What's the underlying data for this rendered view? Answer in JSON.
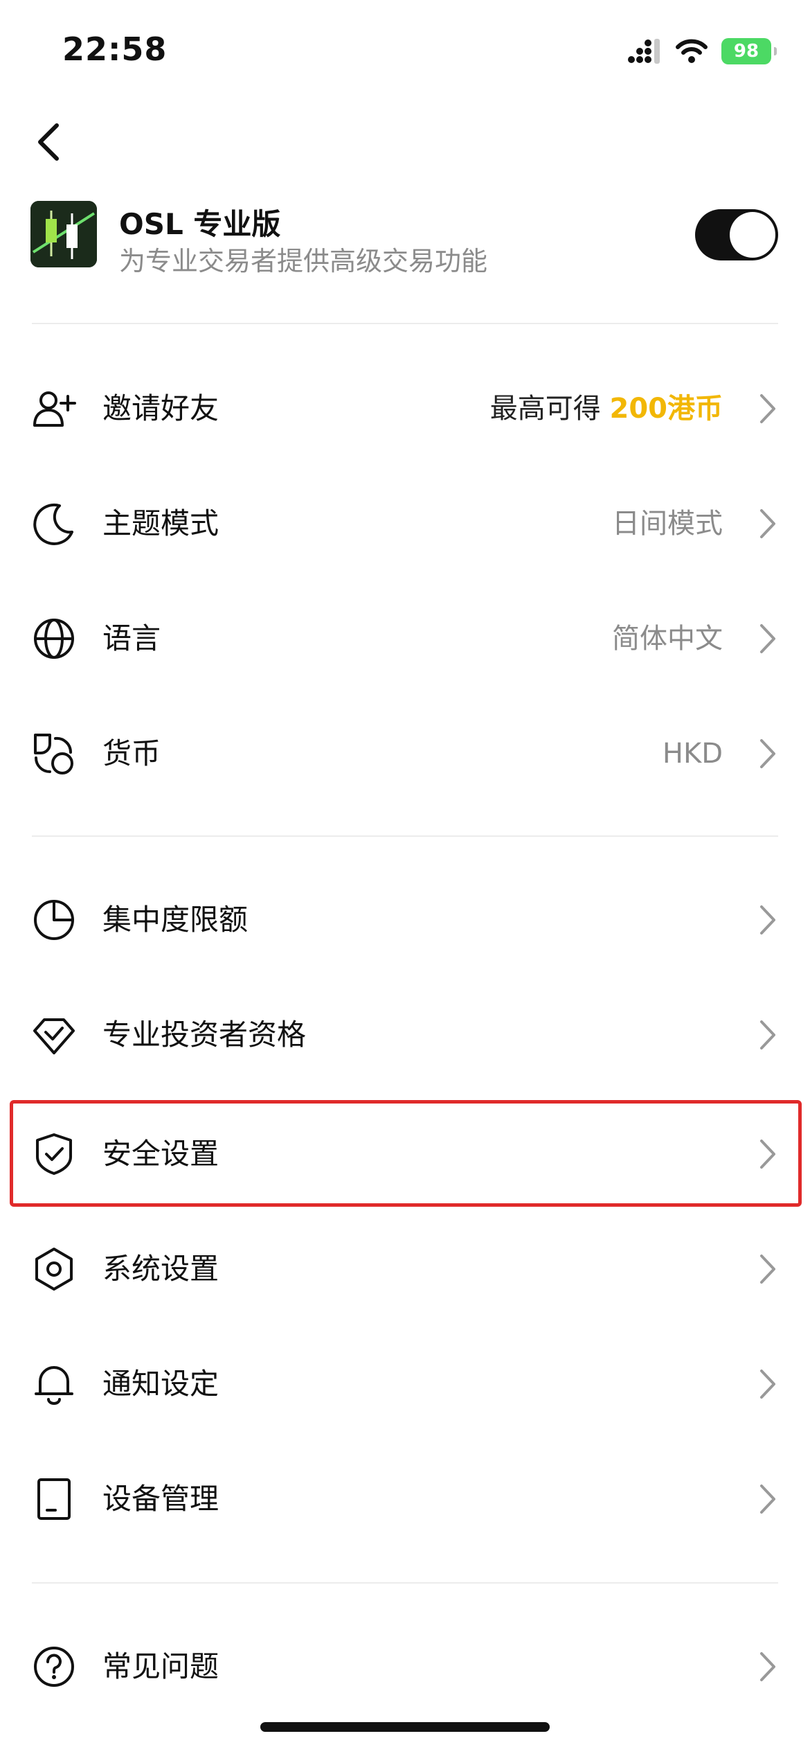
{
  "status_bar": {
    "time": "22:58",
    "battery": "98"
  },
  "pro_mode": {
    "title": "OSL 专业版",
    "subtitle": "为专业交易者提供高级交易功能",
    "enabled": true
  },
  "groups": [
    {
      "items": [
        {
          "label": "邀请好友",
          "icon": "add-user-icon",
          "value_prefix": "最高可得 ",
          "value_accent": "200港币"
        },
        {
          "label": "主题模式",
          "icon": "moon-icon",
          "value": "日间模式"
        },
        {
          "label": "语言",
          "icon": "globe-icon",
          "value": "简体中文"
        },
        {
          "label": "货币",
          "icon": "currency-icon",
          "value": "HKD"
        }
      ]
    },
    {
      "items": [
        {
          "label": "集中度限额",
          "icon": "pie-chart-icon"
        },
        {
          "label": "专业投资者资格",
          "icon": "diamond-check-icon"
        },
        {
          "label": "安全设置",
          "icon": "shield-check-icon",
          "highlighted": true
        },
        {
          "label": "系统设置",
          "icon": "hexagon-settings-icon"
        },
        {
          "label": "通知设定",
          "icon": "bell-icon"
        },
        {
          "label": "设备管理",
          "icon": "device-icon"
        }
      ]
    },
    {
      "items": [
        {
          "label": "常见问题",
          "icon": "question-icon"
        }
      ]
    }
  ],
  "colors": {
    "accent": "#f2b705",
    "highlight_border": "#e02a2a",
    "battery": "#4cd964",
    "secondary_text": "#8b8b8b"
  }
}
